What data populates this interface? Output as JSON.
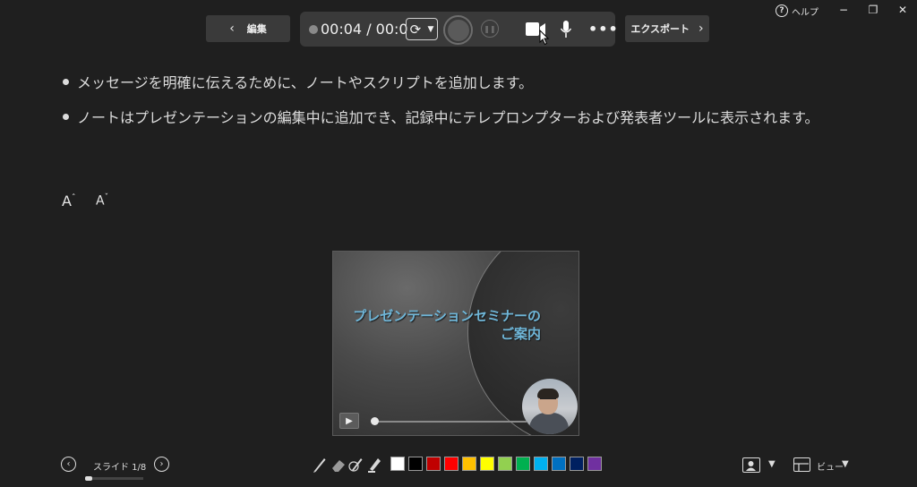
{
  "titlebar": {
    "help_label": "ヘルプ",
    "minimize_glyph": "−",
    "restore_glyph": "❐",
    "close_glyph": "✕"
  },
  "toolbar": {
    "edit_label": "編集",
    "timer": "00:04 / 00:04",
    "export_label": "エクスポート",
    "more_glyph": "•••",
    "icons": [
      "chevron-left-icon",
      "retake-icon",
      "record-icon",
      "pause-icon",
      "camera-icon",
      "microphone-icon",
      "more-icon",
      "chevron-right-icon"
    ]
  },
  "notes": {
    "lines": [
      "メッセージを明確に伝えるために、ノートやスクリプトを追加します。",
      "ノートはプレゼンテーションの編集中に追加でき、記録中にテレプロンプターおよび発表者ツールに表示されます。"
    ],
    "font_increase": "A",
    "font_decrease": "A"
  },
  "slide": {
    "title_line1": "プレゼンテーションセミナーの",
    "title_line2": "ご案内",
    "playback_progress": 0.0
  },
  "bottom": {
    "slide_indicator": "スライド 1/8",
    "slide_current": 1,
    "slide_total": 8,
    "view_label": "ビュー",
    "tools": [
      "pen-icon",
      "eraser-icon",
      "laser-pen-icon",
      "highlighter-icon"
    ],
    "ink_colors": [
      "#ffffff",
      "#000000",
      "#c00000",
      "#ff0000",
      "#ffc000",
      "#ffff00",
      "#92d050",
      "#00b050",
      "#00b0f0",
      "#0070c0",
      "#002060",
      "#7030a0"
    ]
  },
  "colors": {
    "background": "#1f1f1f",
    "panel": "#3a3a3a",
    "slide_title": "#6fb6d8"
  }
}
